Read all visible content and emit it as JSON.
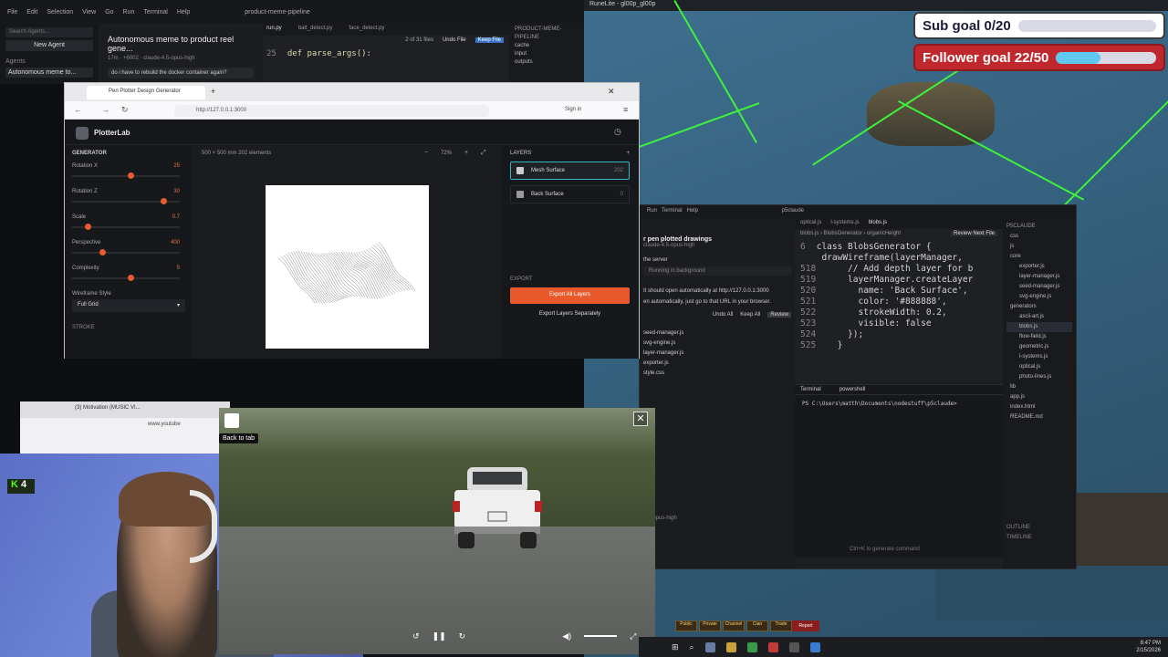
{
  "game": {
    "window_title": "RuneLite - gl00p_gl00p",
    "sub_goal_text": "Sub goal 0/20",
    "sub_goal_progress": 0.0,
    "follower_goal_text": "Follower goal 22/50",
    "follower_goal_progress": 0.44,
    "action_buttons": [
      "Public",
      "Private",
      "Channel",
      "Clan",
      "Trade"
    ],
    "report_label": "Report"
  },
  "code1": {
    "title": "product-meme-pipeline",
    "menu": [
      "File",
      "Edit",
      "Selection",
      "View",
      "Go",
      "Run",
      "Terminal",
      "Help"
    ],
    "search_placeholder": "Search Agents...",
    "new_agent": "New Agent",
    "agents_label": "Agents",
    "agent_item": "Autonomous meme to...",
    "agent_item_time": "17m",
    "chat_title": "Autonomous meme to product reel gene...",
    "chat_meta": "17m · +6002 · claude-4.5-opus-high",
    "chat_question": "do i have to rebuild the docker container again?",
    "tabs": [
      "run.py",
      "batt_detect.py",
      "face_detect.py"
    ],
    "find_status": "2 of 31 files",
    "undo_label": "Undo File",
    "keep_label": "Keep File",
    "line_no": "25",
    "line_no2": "26",
    "code_line": "def parse_args():",
    "tree_header": "PRODUCT-MEME-PIPELINE",
    "tree": [
      "cache",
      "input",
      "outputs"
    ]
  },
  "browser": {
    "tab_title": "Pen Plotter Design Generator",
    "url": "http://127.0.0.1:3000",
    "sign_in": "Sign in",
    "app_name": "PlotterLab",
    "generator_title": "GENERATOR",
    "sliders": [
      {
        "label": "Rotation X",
        "value": "25",
        "pos": 0.52
      },
      {
        "label": "Rotation Z",
        "value": "30",
        "pos": 0.82
      },
      {
        "label": "Scale",
        "value": "0.7",
        "pos": 0.12
      },
      {
        "label": "Perspective",
        "value": "400",
        "pos": 0.25
      },
      {
        "label": "Complexity",
        "value": "5",
        "pos": 0.52
      }
    ],
    "wireframe_label": "Wireframe Style",
    "wireframe_value": "Full Grid",
    "strokes_label": "STROKE",
    "line_width_label": "Line Width",
    "canvas_info": "500 × 500 mm   202 elements",
    "zoom": "72%",
    "layers_title": "LAYERS",
    "layers": [
      {
        "name": "Mesh Surface",
        "count": "202"
      },
      {
        "name": "Back Surface",
        "count": "0"
      }
    ],
    "export_title": "EXPORT",
    "export_all": "Export All Layers",
    "export_separate": "Export Layers Separately"
  },
  "code2": {
    "title": "p5claude",
    "menu": [
      "Run",
      "Terminal",
      "Help"
    ],
    "chat_heading": "r pen plotted drawings",
    "chat_model": "claude-4.5-opus-high",
    "server_label": "the server",
    "running_label": "Running in background",
    "chat_text1": "It should open automatically at http://127.0.0.1:3000",
    "chat_text2": "en automatically, just go to that URL in your browser.",
    "undo_all": "Undo All",
    "keep_all": "Keep All",
    "review": "Review",
    "changed_files": [
      "seed-manager.js",
      "svg-engine.js",
      "layer-manager.js",
      "exporter.js",
      "style.css"
    ],
    "model_footer": "4.5-opus-high",
    "tabs": [
      "optical.js",
      "l-systems.js",
      "blobs.js"
    ],
    "breadcrumb": "blobs.js › BlobsGenerator › organicHeight",
    "review_next": "Review Next File",
    "code_lines": [
      {
        "n": "6",
        "t": "class BlobsGenerator {"
      },
      {
        "n": "",
        "t": "  drawWireframe(layerManager,"
      },
      {
        "n": "518",
        "t": "    // Add depth layer for b"
      },
      {
        "n": "519",
        "t": "    layerManager.createLayer"
      },
      {
        "n": "520",
        "t": "      name: 'Back Surface',"
      },
      {
        "n": "521",
        "t": "      color: '#888888',"
      },
      {
        "n": "522",
        "t": "      strokeWidth: 0.2,"
      },
      {
        "n": "523",
        "t": "      visible: false"
      },
      {
        "n": "524",
        "t": "    });"
      },
      {
        "n": "525",
        "t": "  }"
      }
    ],
    "terminal_tabs": [
      "Terminal",
      "powershell"
    ],
    "terminal_prompt": "PS C:\\Users\\matth\\Documents\\nodestuff\\p5claude>",
    "tree_header": "P5CLAUDE",
    "tree": [
      "css",
      "js",
      "core",
      "exporter.js",
      "layer-manager.js",
      "seed-manager.js",
      "svg-engine.js",
      "generators",
      "ascii-art.js",
      "blobs.js",
      "flow-field.js",
      "geometric.js",
      "l-systems.js",
      "optical.js",
      "photo-lines.js",
      "lib",
      "app.js",
      "index.html",
      "README.md"
    ],
    "outline": "OUTLINE",
    "timeline": "TIMELINE",
    "hint": "Ctrl+K to generate command"
  },
  "pip": {
    "back_to_tab": "Back to tab",
    "close": "✕"
  },
  "youtube": {
    "tab1": "(3) Motivation (MUSIC VI...",
    "tab2": "ATM ROAD",
    "url": "www.youtube",
    "search": "Search"
  },
  "webcam": {
    "badge_num": "4"
  },
  "taskbar": {
    "time": "8:47 PM",
    "date": "2/15/2026"
  }
}
